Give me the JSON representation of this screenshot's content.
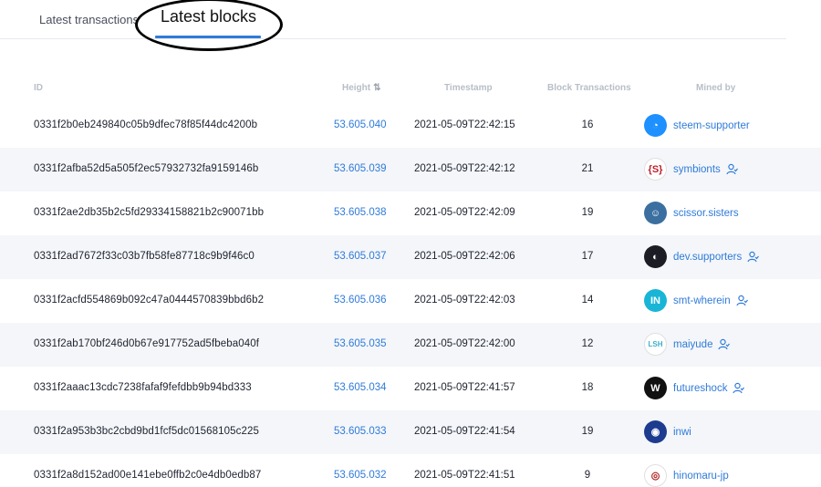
{
  "tabs": {
    "transactions": "Latest transactions",
    "blocks": "Latest blocks"
  },
  "table": {
    "columns": {
      "id": "ID",
      "height": "Height",
      "timestamp": "Timestamp",
      "block_transactions": "Block Transactions",
      "mined_by": "Mined by"
    },
    "rows": [
      {
        "id": "0331f2b0eb249840c05b9dfec78f85f44dc4200b",
        "height": "53.605.040",
        "timestamp": "2021-05-09T22:42:15",
        "tx": "16",
        "miner": "steem-supporter",
        "avatar": "steem-icon",
        "avatar_color": "#1e90ff",
        "verified": false
      },
      {
        "id": "0331f2afba52d5a505f2ec57932732fa9159146b",
        "height": "53.605.039",
        "timestamp": "2021-05-09T22:42:12",
        "tx": "21",
        "miner": "symbionts",
        "avatar": "symbionts-icon",
        "avatar_color": "#ffffff",
        "verified": true
      },
      {
        "id": "0331f2ae2db35b2c5fd29334158821b2c90071bb",
        "height": "53.605.038",
        "timestamp": "2021-05-09T22:42:09",
        "tx": "19",
        "miner": "scissor.sisters",
        "avatar": "portrait-icon",
        "avatar_color": "#3b6fa0",
        "verified": false
      },
      {
        "id": "0331f2ad7672f33c03b7fb58fe87718c9b9f46c0",
        "height": "53.605.037",
        "timestamp": "2021-05-09T22:42:06",
        "tx": "17",
        "miner": "dev.supporters",
        "avatar": "circle-half-icon",
        "avatar_color": "#1c1c24",
        "verified": true
      },
      {
        "id": "0331f2acfd554869b092c47a0444570839bbd6b2",
        "height": "53.605.036",
        "timestamp": "2021-05-09T22:42:03",
        "tx": "14",
        "miner": "smt-wherein",
        "avatar": "in-logo-icon",
        "avatar_color": "#19b5d6",
        "verified": true
      },
      {
        "id": "0331f2ab170bf246d0b67e917752ad5fbeba040f",
        "height": "53.605.035",
        "timestamp": "2021-05-09T22:42:00",
        "tx": "12",
        "miner": "maiyude",
        "avatar": "lsh-logo-icon",
        "avatar_color": "#ffffff",
        "verified": true
      },
      {
        "id": "0331f2aaac13cdc7238fafaf9fefdbb9b94bd333",
        "height": "53.605.034",
        "timestamp": "2021-05-09T22:41:57",
        "tx": "18",
        "miner": "futureshock",
        "avatar": "w-logo-icon",
        "avatar_color": "#111111",
        "verified": true
      },
      {
        "id": "0331f2a953b3bc2cbd9bd1fcf5dc01568105c225",
        "height": "53.605.033",
        "timestamp": "2021-05-09T22:41:54",
        "tx": "19",
        "miner": "inwi",
        "avatar": "inwi-logo-icon",
        "avatar_color": "#1d3c8f",
        "verified": false
      },
      {
        "id": "0331f2a8d152ad00e141ebe0ffb2c0e4db0edb87",
        "height": "53.605.032",
        "timestamp": "2021-05-09T22:41:51",
        "tx": "9",
        "miner": "hinomaru-jp",
        "avatar": "hinomaru-icon",
        "avatar_color": "#ffffff",
        "verified": false
      }
    ]
  },
  "colors": {
    "accent": "#2f7bd9",
    "row_alt": "#f4f6f9"
  }
}
